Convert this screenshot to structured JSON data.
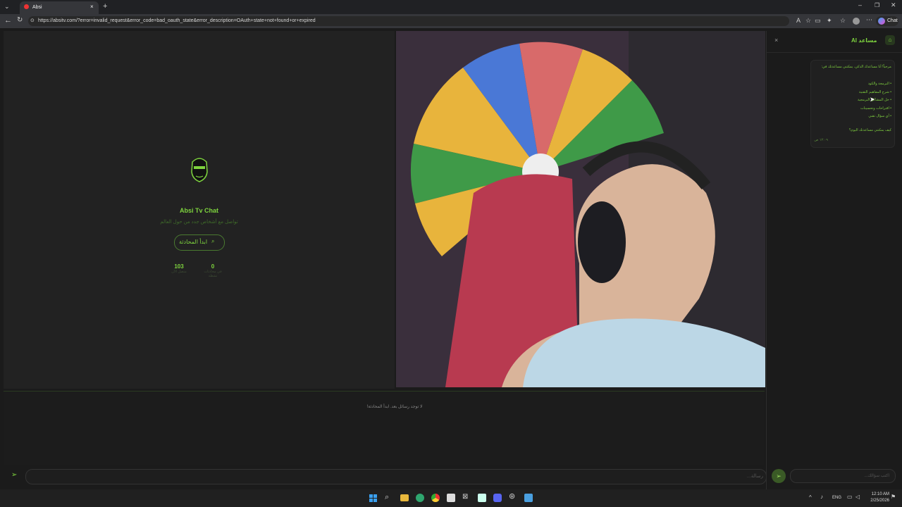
{
  "browser": {
    "tab_title": "Absi",
    "new_tab": "+",
    "url": "https://absitv.com/?error=invalid_request&error_code=bad_oauth_state&error_description=OAuth+state+not+found+or+expired",
    "chat_button": "Chat",
    "window_controls": [
      "minimize",
      "restore",
      "close"
    ]
  },
  "main": {
    "app_name": "Absi Tv Chat",
    "subtitle": "تواصل مع أشخاص جدد من حول العالم",
    "start_button": "ابدأ المحادثة",
    "stats": [
      {
        "value": "103",
        "label": "متصل الآن"
      },
      {
        "value": "0",
        "label": "في محادثات نشطة"
      }
    ],
    "empty_messages": "لا توجد رسائل بعد. ابدأ المحادثة!",
    "message_placeholder": "رسالة..."
  },
  "assistant": {
    "title": "مساعد AI",
    "close": "×",
    "greeting": "مرحباً! أنا مساعدك الذكي. يمكنني مساعدتك في:",
    "bullets": [
      "البرمجة والكود",
      "شرح المفاهيم التقنية",
      "حل المشاكل البرمجية",
      "اقتراحات وتحسينات",
      "أي سؤال تقني"
    ],
    "question": "كيف يمكنني مساعدتك اليوم؟",
    "time": "١٢:٠٩ ص",
    "input_placeholder": "اكتب سؤالك..."
  },
  "taskbar": {
    "lang": "ENG",
    "time": "12:10 AM",
    "date": "2/25/2026"
  },
  "colors": {
    "accent": "#7ed43e",
    "background": "#1b1b1b"
  },
  "icons": [
    "windows-icon",
    "search-icon",
    "files-icon",
    "edge-icon",
    "chrome-icon",
    "store-icon",
    "excel-icon",
    "word-icon",
    "discord-icon",
    "steam-icon",
    "app-icon"
  ]
}
